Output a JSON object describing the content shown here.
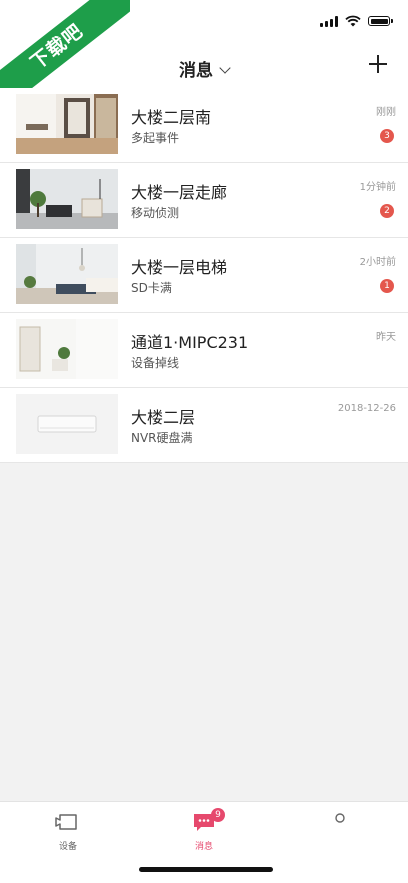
{
  "watermark": "下载吧",
  "nav": {
    "title": "消息"
  },
  "messages": [
    {
      "title": "大楼二层南",
      "subtitle": "多起事件",
      "time": "刚刚",
      "badge": "3"
    },
    {
      "title": "大楼一层走廊",
      "subtitle": "移动侦测",
      "time": "1分钟前",
      "badge": "2"
    },
    {
      "title": "大楼一层电梯",
      "subtitle": "SD卡满",
      "time": "2小时前",
      "badge": "1"
    },
    {
      "title": "通道1·MIPC231",
      "subtitle": "设备掉线",
      "time": "昨天",
      "badge": ""
    },
    {
      "title": "大楼二层",
      "subtitle": "NVR硬盘满",
      "time": "2018-12-26",
      "badge": ""
    }
  ],
  "tabs": {
    "devices": "设备",
    "messages": "消息",
    "messages_badge": "9"
  },
  "colors": {
    "accent": "#e6496d",
    "badge": "#e4574d",
    "watermark": "#1e9e4a"
  }
}
